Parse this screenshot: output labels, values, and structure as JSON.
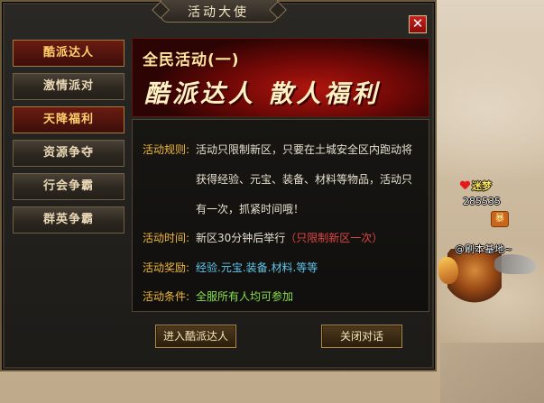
{
  "scene": {
    "character": {
      "name": "迷梦",
      "hp": "285535",
      "badge": "暴",
      "title": "@刷本基地~"
    }
  },
  "dialog": {
    "title": "活动大使",
    "close_symbol": "✕",
    "tabs": [
      {
        "label": "酷派达人",
        "active": true
      },
      {
        "label": "激情派对",
        "active": false
      },
      {
        "label": "天降福利",
        "active": true
      },
      {
        "label": "资源争夺",
        "active": false
      },
      {
        "label": "行会争霸",
        "active": false
      },
      {
        "label": "群英争霸",
        "active": false
      }
    ],
    "banner": {
      "heading": "全民活动(一)",
      "slogan": "酷派达人 散人福利"
    },
    "rules": {
      "label": "活动规则:",
      "lines": [
        "活动只限制新区，只要在土城安全区内跑动将",
        "获得经验、元宝、装备、材料等物品，活动只",
        "有一次，抓紧时间哦！"
      ]
    },
    "time": {
      "label": "活动时间:",
      "text": "新区30分钟后举行",
      "note": "（只限制新区一次）"
    },
    "reward": {
      "label": "活动奖励:",
      "text": "经验.元宝.装备.材料.等等"
    },
    "condition": {
      "label": "活动条件:",
      "text": "全服所有人均可参加"
    },
    "buttons": {
      "enter": "进入酷派达人",
      "close": "关闭对话"
    }
  },
  "colors": {
    "label": "#f0b73a",
    "body_text": "#e6e0d0",
    "highlight_red": "#e24545",
    "reward_cyan": "#5fc6ec",
    "condition_green": "#8be04e",
    "active_tab_text": "#ffcf6b"
  }
}
